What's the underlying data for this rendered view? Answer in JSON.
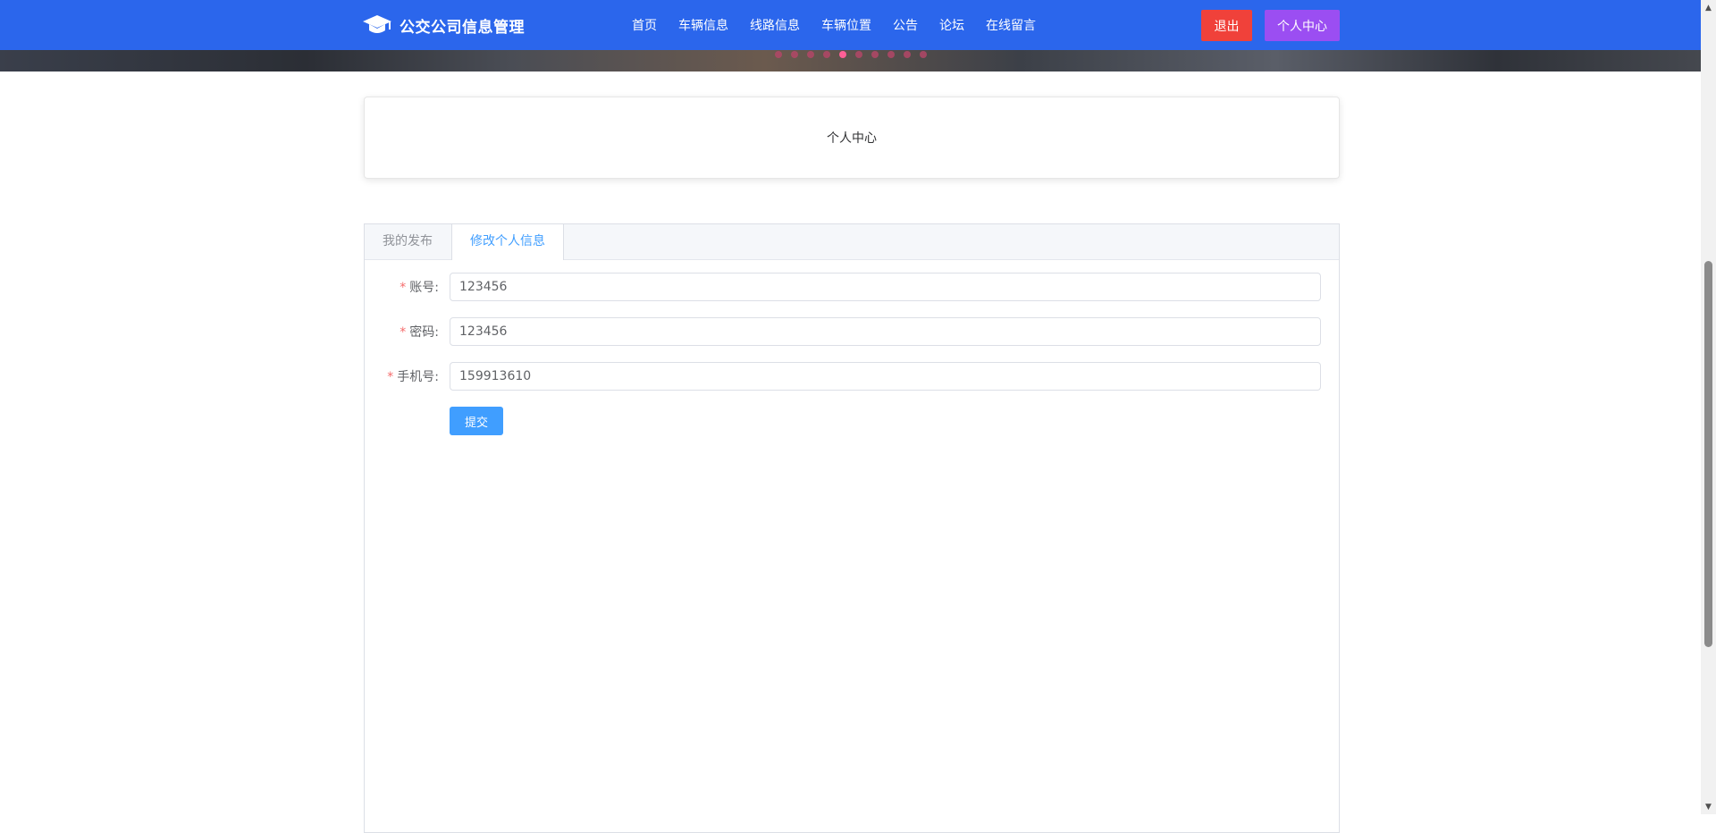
{
  "header": {
    "logo_icon": "graduation-cap-icon",
    "title": "公交公司信息管理",
    "nav": [
      "首页",
      "车辆信息",
      "线路信息",
      "车辆位置",
      "公告",
      "论坛",
      "在线留言"
    ],
    "logout_label": "退出",
    "profile_label": "个人中心",
    "colors": {
      "bar": "#2b66ec",
      "logout": "#f0413a",
      "profile": "#9b4ef2"
    }
  },
  "banner": {
    "carousel_dot_count": 10,
    "active_dot_index": 4
  },
  "page": {
    "title": "个人中心"
  },
  "tabs": [
    {
      "label": "我的发布",
      "active": false
    },
    {
      "label": "修改个人信息",
      "active": true
    }
  ],
  "form": {
    "fields": [
      {
        "label": "账号:",
        "required": true,
        "value": "123456"
      },
      {
        "label": "密码:",
        "required": true,
        "value": "123456"
      },
      {
        "label": "手机号:",
        "required": true,
        "value": "159913610"
      }
    ],
    "submit_label": "提交"
  }
}
